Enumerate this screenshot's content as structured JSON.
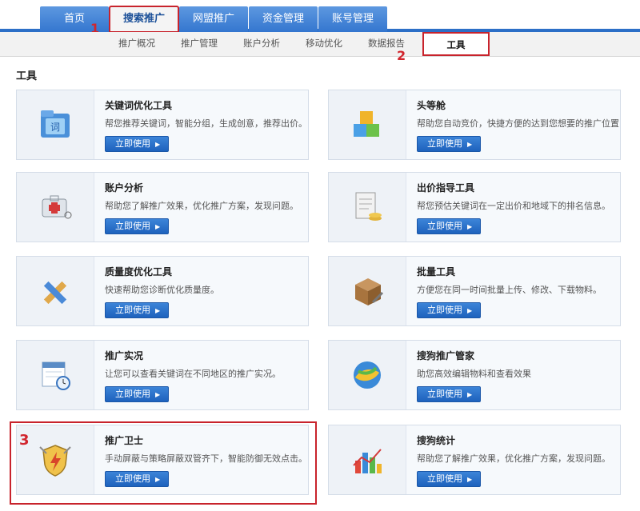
{
  "main_nav": {
    "tabs": [
      {
        "label": "首页"
      },
      {
        "label": "搜索推广"
      },
      {
        "label": "网盟推广"
      },
      {
        "label": "资金管理"
      },
      {
        "label": "账号管理"
      }
    ],
    "active_index": 1
  },
  "sub_nav": {
    "items": [
      {
        "label": "推广概况"
      },
      {
        "label": "推广管理"
      },
      {
        "label": "账户分析"
      },
      {
        "label": "移动优化"
      },
      {
        "label": "数据报告"
      },
      {
        "label": "工具"
      }
    ],
    "active_index": 5
  },
  "markers": {
    "one": "1",
    "two": "2",
    "three": "3"
  },
  "section_title": "工具",
  "button_label": "立即使用",
  "tools": [
    {
      "title": "关键词优化工具",
      "desc": "帮您推荐关键词，智能分组，生成创意，推荐出价。",
      "icon": "folder-icon"
    },
    {
      "title": "头等舱",
      "desc": "帮助您自动竞价，快捷方便的达到您想要的推广位置",
      "icon": "blocks-icon"
    },
    {
      "title": "账户分析",
      "desc": "帮助您了解推广效果，优化推广方案，发现问题。",
      "icon": "medical-kit-icon"
    },
    {
      "title": "出价指导工具",
      "desc": "帮您预估关键词在一定出价和地域下的排名信息。",
      "icon": "document-coins-icon"
    },
    {
      "title": "质量度优化工具",
      "desc": "快速帮助您诊断优化质量度。",
      "icon": "pencil-ruler-icon"
    },
    {
      "title": "批量工具",
      "desc": "方便您在同一时间批量上传、修改、下载物料。",
      "icon": "box-tools-icon"
    },
    {
      "title": "推广实况",
      "desc": "让您可以查看关键词在不同地区的推广实况。",
      "icon": "calendar-clock-icon"
    },
    {
      "title": "搜狗推广管家",
      "desc": "助您高效编辑物料和查看效果",
      "icon": "globe-icon"
    },
    {
      "title": "推广卫士",
      "desc": "手动屏蔽与策略屏蔽双管齐下，智能防御无效点击。",
      "icon": "shield-icon"
    },
    {
      "title": "搜狗统计",
      "desc": "帮助您了解推广效果，优化推广方案，发现问题。",
      "icon": "bar-chart-icon"
    }
  ]
}
